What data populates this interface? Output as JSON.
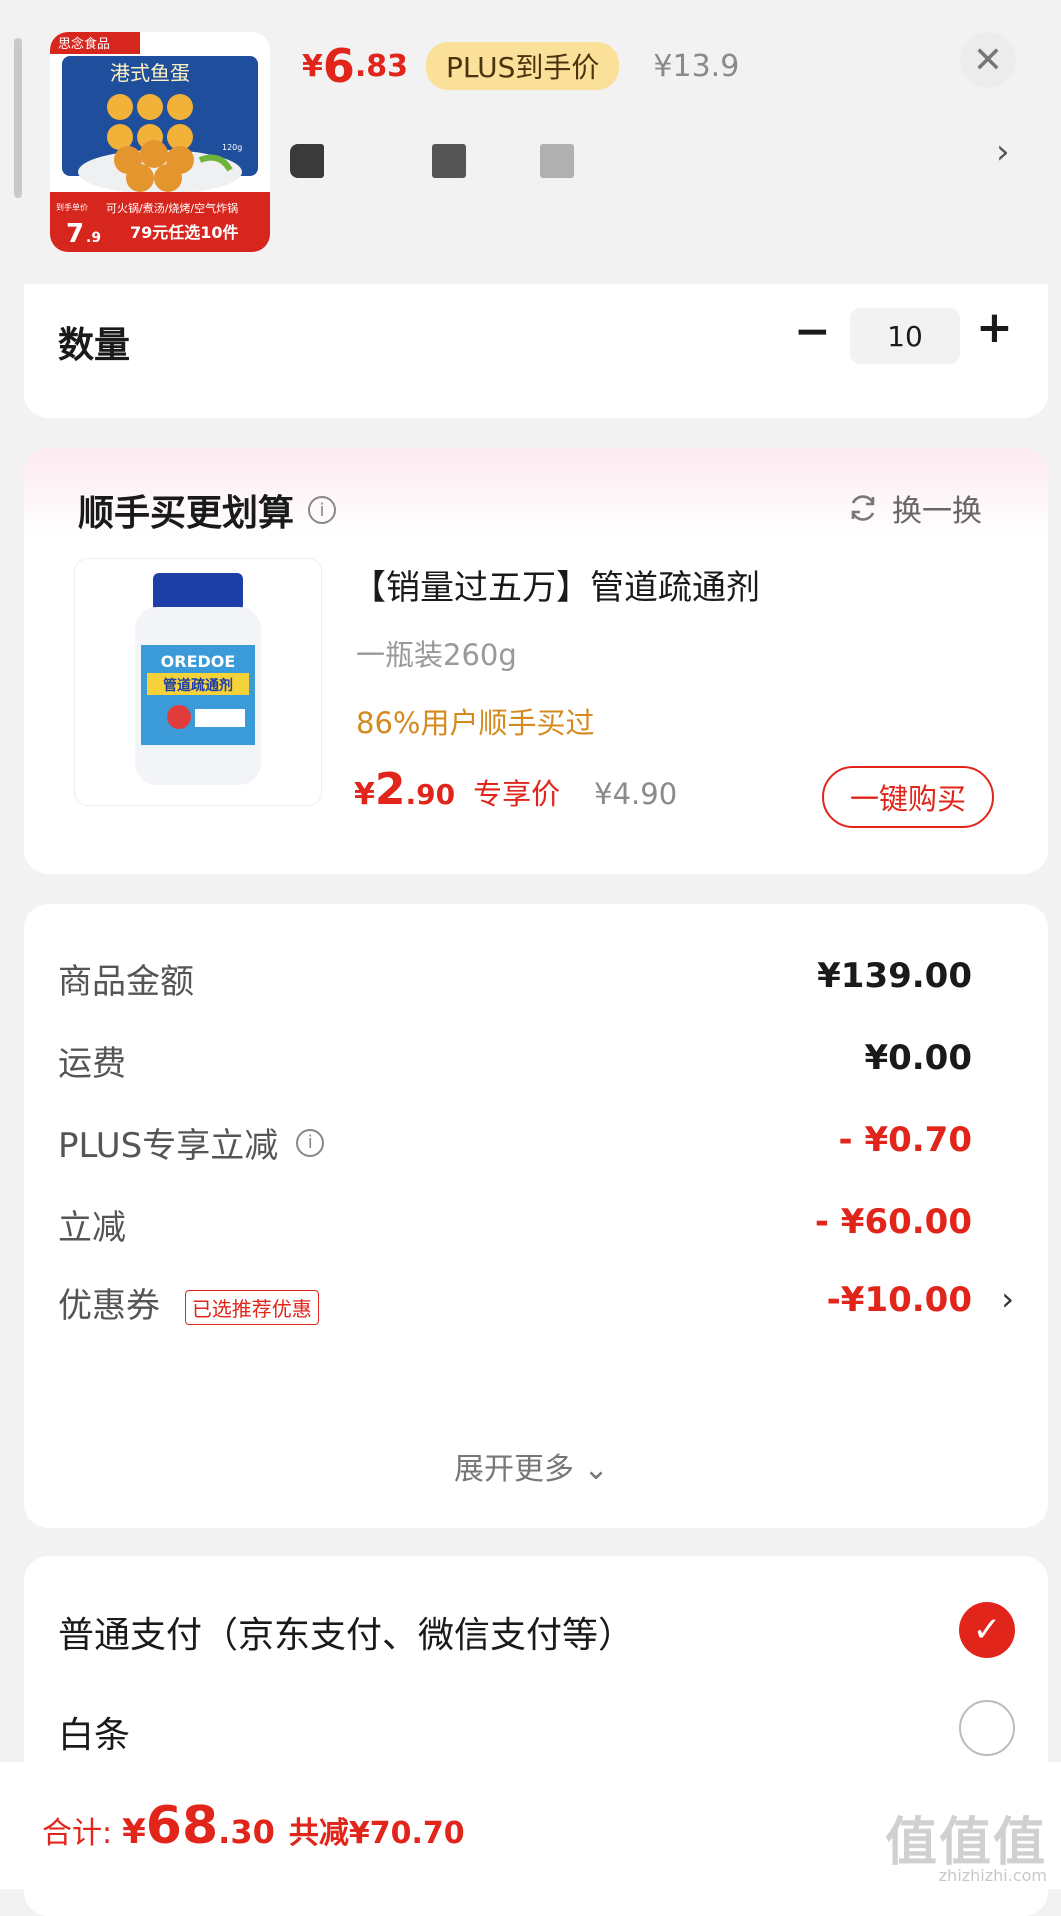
{
  "product": {
    "thumb_brand": "思念食品",
    "thumb_title": "港式鱼蛋",
    "thumb_weight": "120g",
    "thumb_promo_line1": "可火锅/煮汤/烧烤/空气炸锅",
    "thumb_promo_line2": "79元任选10件",
    "thumb_price_small": "到手单价",
    "thumb_price": "7",
    "thumb_price_dec": ".9",
    "price_symbol": "¥",
    "price_int": "6",
    "price_dec": ".83",
    "plus_badge": "PLUS到手价",
    "original_price": "¥13.9",
    "close_icon": "close-icon",
    "spec_swatch_colors": [
      "#3a3a3a",
      "#555555",
      "#b0b0b0"
    ]
  },
  "quantity": {
    "label": "数量",
    "value": "10",
    "minus": "−",
    "plus": "+"
  },
  "bundle": {
    "title": "顺手买更划算",
    "info_icon": "i",
    "refresh_label": "换一换",
    "item_name": "【销量过五万】管道疏通剂",
    "item_spec": "一瓶装260g",
    "social_proof": "86%用户顺手买过",
    "price_symbol": "¥",
    "price_int": "2",
    "price_dec": ".90",
    "exclusive_label": "专享价",
    "original_price": "¥4.90",
    "buy_button": "一键购买",
    "bottle_brand": "OREDOE",
    "bottle_label": "管道疏通剂"
  },
  "summary": {
    "rows": [
      {
        "label": "商品金额",
        "value": "¥139.00"
      },
      {
        "label": "运费",
        "value": "¥0.00"
      },
      {
        "label": "PLUS专享立减",
        "value": "- ¥0.70"
      },
      {
        "label": "立减",
        "value": "- ¥60.00"
      },
      {
        "label": "优惠券",
        "value": "-¥10.00"
      }
    ],
    "coupon_tag": "已选推荐优惠",
    "expand_more": "展开更多 ⌄"
  },
  "payment": {
    "normal_label": "普通支付（京东支付、微信支付等）",
    "baitiao_label": "白条"
  },
  "footer": {
    "total_label": "合计:",
    "total_symbol": "¥",
    "total_int": "68",
    "total_dec": ".30",
    "saved": "共减¥70.70",
    "watermark": "值值值",
    "watermark_url": "zhizhizhi.com"
  },
  "colors": {
    "accent_red": "#e1251b",
    "plus_gold": "#fbe09a",
    "social_orange": "#d48a1e"
  }
}
